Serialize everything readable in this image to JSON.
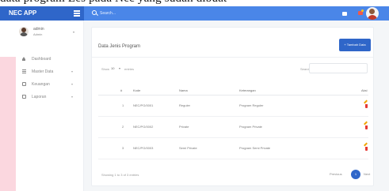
{
  "caption": "data program Les pada Nec yang sudah dibuat",
  "app": {
    "brand": "NEC APP",
    "search_placeholder": "Search..."
  },
  "user": {
    "name": "admin",
    "role": "Admin"
  },
  "sidebar": {
    "items": [
      {
        "label": "Dashboard",
        "icon": "home-icon",
        "caret": ""
      },
      {
        "label": "Master Data",
        "icon": "list-icon",
        "caret": "▾"
      },
      {
        "label": "Keuangan",
        "icon": "money-icon",
        "caret": "▾"
      },
      {
        "label": "Laporan",
        "icon": "document-icon",
        "caret": "▾"
      }
    ]
  },
  "main": {
    "title": "Data Jenis Program",
    "add_button": "+ Tambah Data",
    "show_label": "Show",
    "show_value": "10",
    "entries_label": "entries",
    "search_label": "Search:",
    "columns": [
      "#",
      "Kode",
      "Nama",
      "Keterangan",
      "Aksi"
    ],
    "rows": [
      {
        "no": "1",
        "kode": "NEC/PG/0001",
        "nama": "Reguler",
        "keterangan": "Program Reguler"
      },
      {
        "no": "2",
        "kode": "NEC/PG/0002",
        "nama": "Private",
        "keterangan": "Program Private"
      },
      {
        "no": "3",
        "kode": "NEC/PG/0003",
        "nama": "Semi Private",
        "keterangan": "Program Semi Private"
      }
    ],
    "info": "Showing 1 to 3 of 3 entries",
    "pagination": {
      "previous": "Previous",
      "current": "1",
      "next": "Next"
    }
  },
  "colors": {
    "brand": "#2f66c9",
    "topbar": "#4a86e8",
    "edit": "#f0a500",
    "delete": "#e53935"
  }
}
